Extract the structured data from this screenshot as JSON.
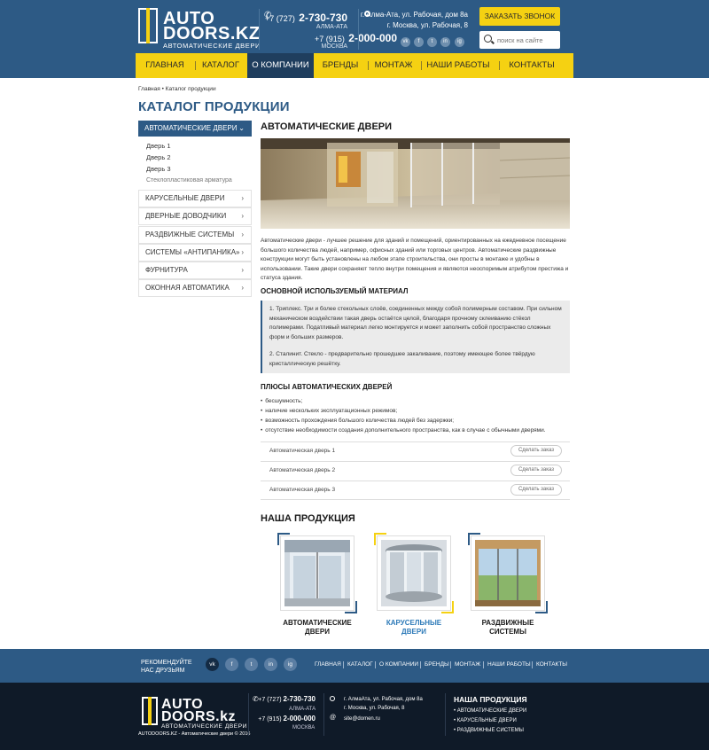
{
  "header": {
    "logo_line1": "AUTO",
    "logo_line2": "DOORS.KZ",
    "logo_subtitle": "АВТОМАТИЧЕСКИЕ ДВЕРИ",
    "phones": [
      {
        "code": "+7 (727)",
        "number": "2-730-730",
        "city": "АЛМА-АТА"
      },
      {
        "code": "+7 (915)",
        "number": "2-000-000",
        "city": "МОСКВА"
      }
    ],
    "addresses": [
      "г. Алма-Ата, ул. Рабочая, дом 8а",
      "г. Москва, ул. Рабочая, 8"
    ],
    "social": [
      "vk",
      "f",
      "t",
      "in",
      "ig"
    ],
    "callback_label": "ЗАКАЗАТЬ ЗВОНОК",
    "search_placeholder": "поиск на сайте"
  },
  "nav": {
    "items": [
      "ГЛАВНАЯ",
      "КАТАЛОГ",
      "О КОМПАНИИ",
      "БРЕНДЫ",
      "МОНТАЖ",
      "НАШИ РАБОТЫ",
      "КОНТАКТЫ"
    ],
    "active": "О КОМПАНИИ"
  },
  "breadcrumb": {
    "home": "Главная",
    "current": "Каталог продукции"
  },
  "page_title": "КАТАЛОГ ПРОДУКЦИИ",
  "sidebar": {
    "active": "АВТОМАТИЧЕСКИЕ ДВЕРИ",
    "subitems": [
      "Дверь 1",
      "Дверь 2",
      "Дверь 3",
      "Стеклопластиковая арматура"
    ],
    "items": [
      "КАРУСЕЛЬНЫЕ ДВЕРИ",
      "ДВЕРНЫЕ ДОВОДЧИКИ",
      "РАЗДВИЖНЫЕ СИСТЕМЫ",
      "СИСТЕМЫ «АНТИПАНИКА»",
      "ФУРНИТУРА",
      "ОКОННАЯ АВТОМАТИКА"
    ]
  },
  "content": {
    "heading": "АВТОМАТИЧЕСКИЕ ДВЕРИ",
    "intro": "Автоматические двери - лучшее решение для зданий и помещений, ориентированных на ежедневное посещение большого количества людей, например, офисных зданий или торговых центров. Автоматические раздвижные конструкции могут быть установлены на любом этапе строительства, они просты в монтаже и удобны в использовании. Такие двери сохраняют тепло внутри помещения и являются неоспоримым атрибутом престижа и статуса здания.",
    "material_heading": "ОСНОВНОЙ ИСПОЛЬЗУЕМЫЙ МАТЕРИАЛ",
    "material_1": "1. Триплекс. Три и более стекольных слоёв, соединенных между собой полимерным составом. При сильном механическом воздействии такая дверь остаётся целой, благодаря прочному склеиванию стёкол полимерами. Податливый материал легко монтируется и может заполнить собой пространство сложных форм и больших размеров.",
    "material_2": "2. Сталинит. Стекло - предварительно прошедшее закаливание, поэтому имеющее более твёрдую кристаллическую решётку.",
    "pros_heading": "ПЛЮСЫ АВТОМАТИЧЕСКИХ ДВЕРЕЙ",
    "pros": [
      "бесшумность;",
      "наличие нескольких эксплуатационных режимов;",
      "возможность прохождения большого количества людей без задержки;",
      "отсутствие необходимости создания дополнительного пространства, как в случае с обычными дверями."
    ],
    "orders": [
      {
        "name": "Автоматическая дверь 1",
        "button": "Сделать заказ"
      },
      {
        "name": "Автоматическая дверь 2",
        "button": "Сделать заказ"
      },
      {
        "name": "Автоматическая дверь 3",
        "button": "Сделать заказ"
      }
    ],
    "products_heading": "НАША ПРОДУКЦИЯ",
    "products": [
      {
        "line1": "АВТОМАТИЧЕСКИЕ",
        "line2": "ДВЕРИ"
      },
      {
        "line1": "КАРУСЕЛЬНЫЕ",
        "line2": "ДВЕРИ"
      },
      {
        "line1": "РАЗДВИЖНЫЕ",
        "line2": "СИСТЕМЫ"
      }
    ]
  },
  "footer": {
    "recommend_line1": "РЕКОМЕНДУЙТЕ",
    "recommend_line2": "НАС ДРУЗЬЯМ",
    "social": [
      "vk",
      "f",
      "t",
      "in",
      "ig"
    ],
    "nav": [
      "ГЛАВНАЯ",
      "КАТАЛОГ",
      "О КОМПАНИИ",
      "БРЕНДЫ",
      "МОНТАЖ",
      "НАШИ РАБОТЫ",
      "КОНТАКТЫ"
    ],
    "logo_line1": "AUTO",
    "logo_line2": "DOORS.kz",
    "logo_subtitle": "АВТОМАТИЧЕСКИЕ ДВЕРИ",
    "copyright": "AUTODOORS.KZ - Автоматические двери © 2016",
    "phones": [
      {
        "code": "+7 (727)",
        "number": "2-730-730",
        "city": "АЛМА-АТА"
      },
      {
        "code": "+7 (915)",
        "number": "2-000-000",
        "city": "МОСКВА"
      }
    ],
    "addresses": [
      "г. АлмаАта, ул. Рабочая, дом 8а",
      "г. Москва, ул. Рабочая, 8"
    ],
    "email": "site@domen.ru",
    "products_heading": "НАША ПРОДУКЦИЯ",
    "products": [
      "• АВТОМАТИЧЕСКИЕ ДВЕРИ",
      "• КАРУСЕЛЬНЫЕ ДВЕРИ",
      "• РАЗДВИЖНЫЕ СИСТЕМЫ"
    ]
  },
  "colors": {
    "primary": "#2d5a85",
    "accent": "#f5d112",
    "nav_active": "#1f3e5e",
    "footer_dark": "#0f1a28"
  }
}
